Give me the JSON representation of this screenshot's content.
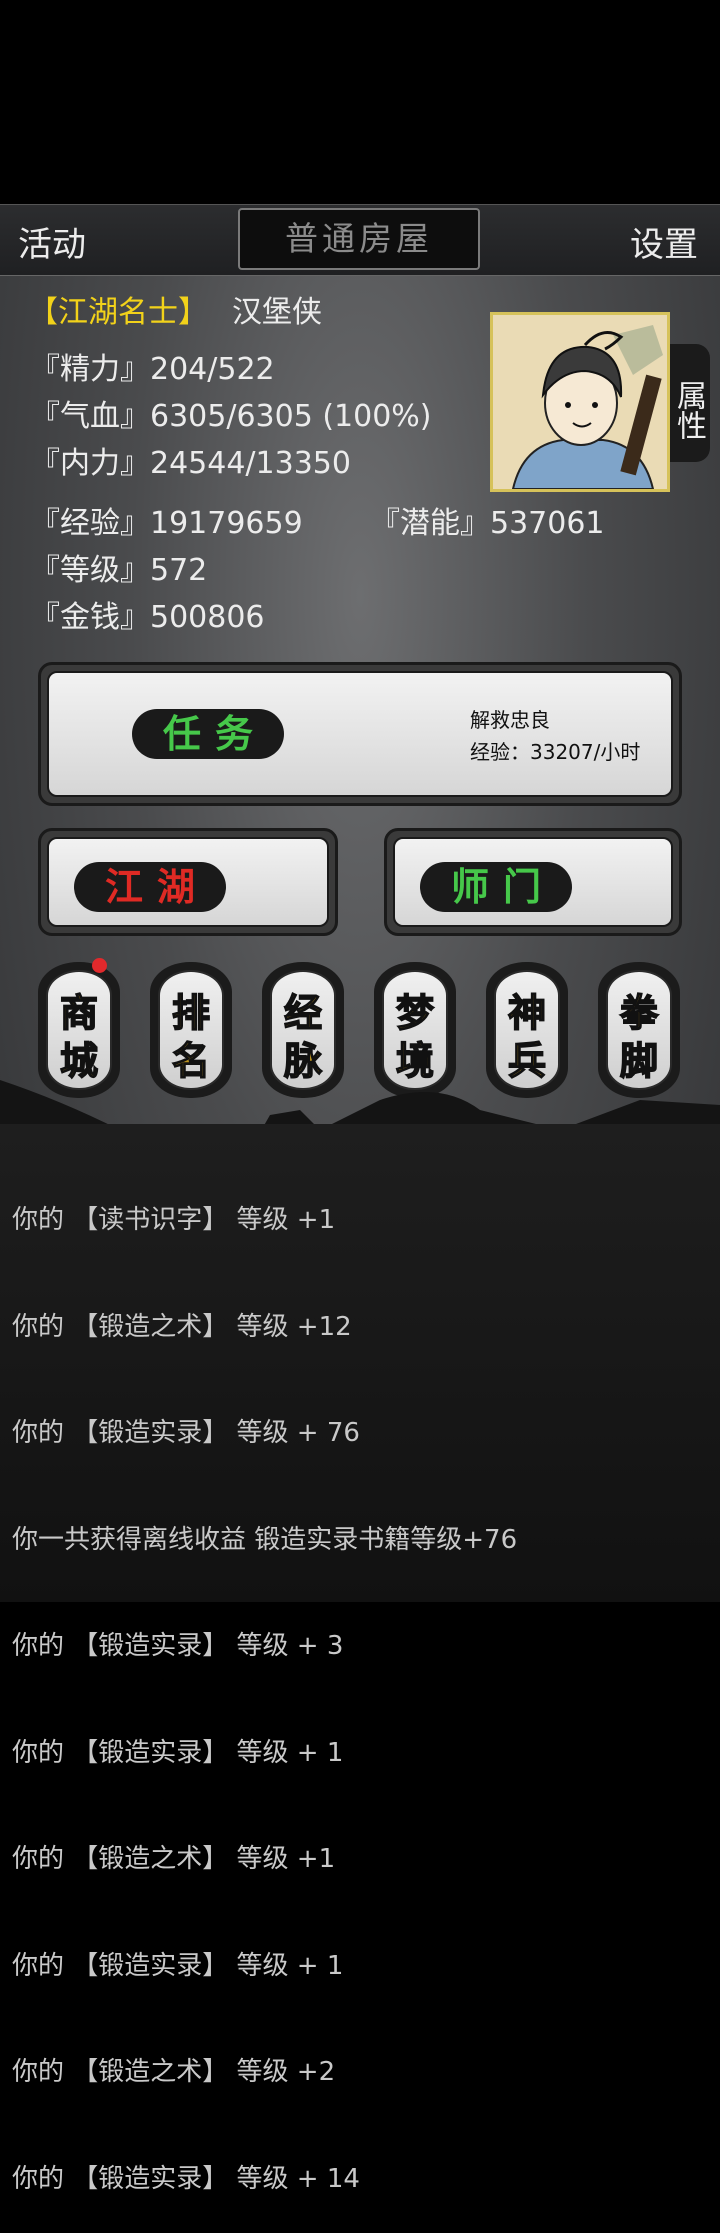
{
  "topbar": {
    "left_label": "活动",
    "title": "普通房屋",
    "right_label": "设置"
  },
  "player": {
    "title_tag": "【江湖名士】",
    "name": "汉堡侠",
    "stats": {
      "jingli": "『精力』204/522",
      "qixue": "『气血』6305/6305 (100%)",
      "neili": "『内力』24544/13350",
      "jingyan": "『经验』19179659",
      "qianneng": "『潜能』537061",
      "dengji": "『等级』572",
      "jinqian": "『金钱』500806"
    },
    "attr_tab": "属性"
  },
  "task": {
    "label": "任务",
    "name": "解救忠良",
    "exp_rate": "经验：33207/小时"
  },
  "buttons": {
    "jianghu": "江湖",
    "shimen": "师门"
  },
  "menu": [
    {
      "top": "商",
      "bottom": "城"
    },
    {
      "top": "排",
      "bottom": "名"
    },
    {
      "top": "经",
      "bottom": "脉"
    },
    {
      "top": "梦",
      "bottom": "境"
    },
    {
      "top": "神",
      "bottom": "兵"
    },
    {
      "top": "拳",
      "bottom": "脚"
    }
  ],
  "log": [
    "你的 【读书识字】 等级 +1",
    "你的 【锻造之术】 等级 +12",
    "你的 【锻造实录】 等级 + 76",
    "你一共获得离线收益 锻造实录书籍等级+76",
    "你的 【锻造实录】 等级 + 3",
    "你的 【锻造实录】 等级 + 1",
    "你的 【锻造之术】 等级 +1",
    "你的 【锻造实录】 等级 + 1",
    "你的 【锻造之术】 等级 +2",
    "你的 【锻造实录】 等级 + 14"
  ],
  "colors": {
    "accent_yellow": "#f2d21a",
    "red_text": "#e02a24",
    "green_text": "#46c84a",
    "gold_text": "#b8901e"
  }
}
